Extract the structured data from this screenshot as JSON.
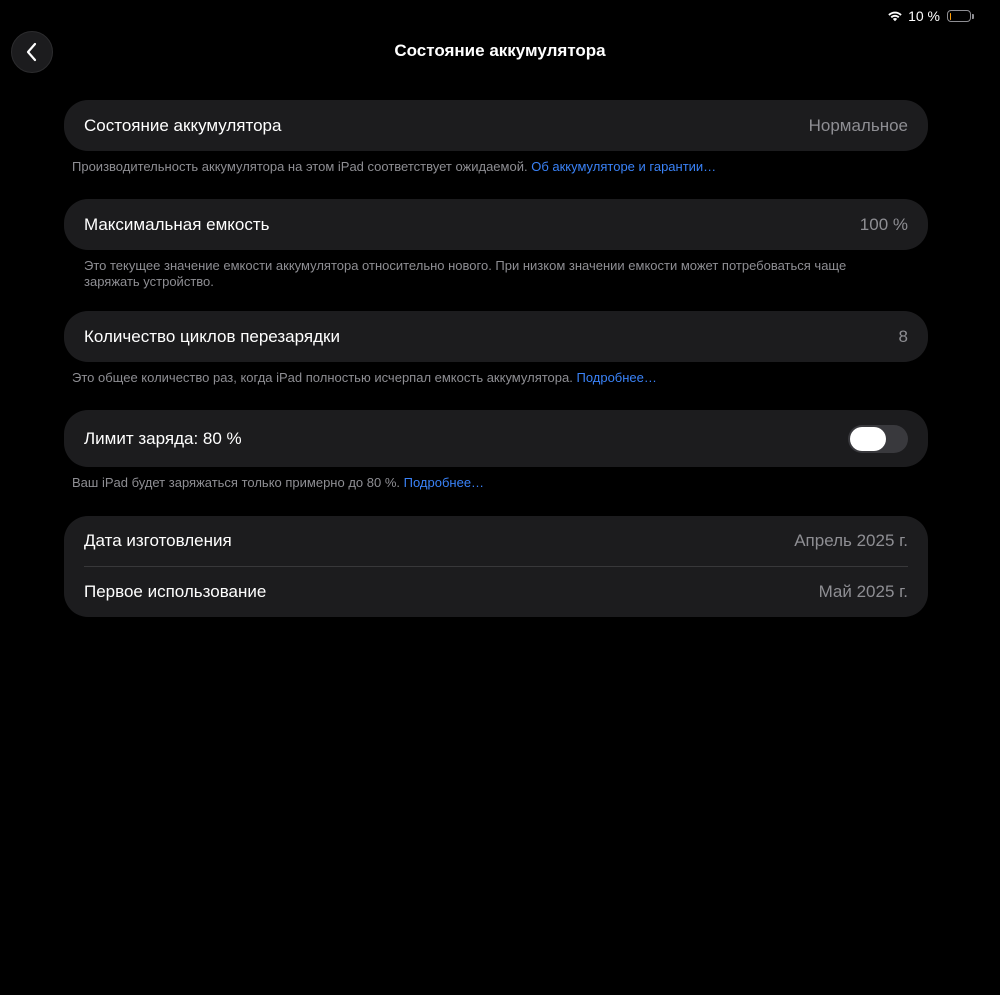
{
  "status_bar": {
    "battery_text": "10 %",
    "battery_level": 0.1,
    "battery_color": "#ff9f0a",
    "wifi_icon": "wifi-icon"
  },
  "nav": {
    "title": "Состояние аккумулятора",
    "back_icon": "chevron-left-icon"
  },
  "battery_health": {
    "label": "Состояние аккумулятора",
    "value": "Нормальное",
    "footer_text": "Производительность аккумулятора на этом iPad соответствует ожидаемой.",
    "footer_link": "Об аккумуляторе и гарантии…"
  },
  "max_capacity": {
    "label": "Максимальная емкость",
    "value": "100 %",
    "footer_line1": "Это текущее значение емкости аккумулятора относительно нового. При низком значении емкости может потребоваться чаще",
    "footer_line2": "заряжать устройство."
  },
  "cycle_count": {
    "label": "Количество циклов перезарядки",
    "value": "8",
    "footer_text": "Это общее количество раз, когда iPad полностью исчерпал емкость аккумулятора.",
    "footer_link": "Подробнее…"
  },
  "charge_limit": {
    "label": "Лимит заряда: 80 %",
    "toggle_on": false,
    "footer_text": "Ваш iPad будет заряжаться только примерно до 80 %.",
    "footer_link": "Подробнее…"
  },
  "dates": {
    "manufacture_label": "Дата изготовления",
    "manufacture_value": "Апрель 2025 г.",
    "first_use_label": "Первое использование",
    "first_use_value": "Май 2025 г."
  },
  "colors": {
    "background": "#000000",
    "card": "#1c1c1e",
    "secondary_text": "#8e8e93",
    "link": "#3a82f7"
  }
}
